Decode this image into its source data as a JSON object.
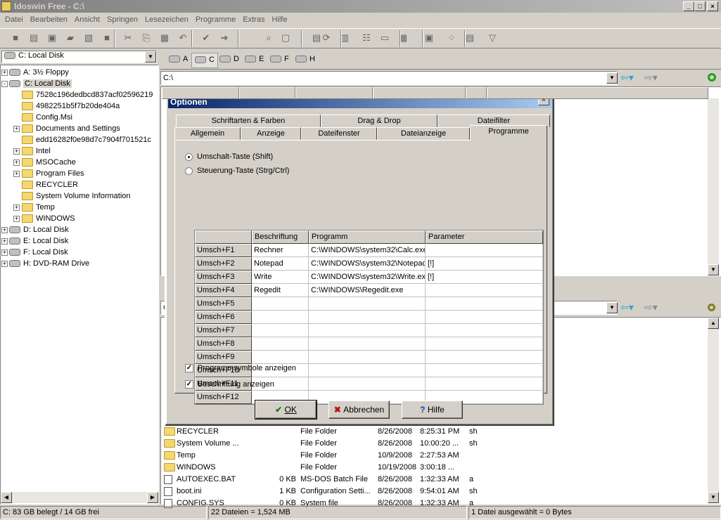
{
  "window": {
    "title": "Idoswin Free - C:\\",
    "controls": [
      "_",
      "□",
      "×"
    ]
  },
  "menu": [
    "Datei",
    "Bearbeiten",
    "Ansicht",
    "Springen",
    "Lesezeichen",
    "Programme",
    "Extras",
    "Hilfe"
  ],
  "toolbar_icons": [
    "stop",
    "properties",
    "cmd",
    "new-folder",
    "move",
    "delete",
    "cut",
    "copy",
    "paste",
    "undo",
    "check",
    "exit",
    "find",
    "folder-view",
    "list",
    "refresh",
    "folder-compare",
    "details",
    "small-icons",
    "grid",
    "preview",
    "thumbs",
    "text",
    "filter"
  ],
  "left": {
    "drive_combo": "C: Local Disk",
    "tree": [
      {
        "label": "A: 3½ Floppy",
        "level": 0,
        "type": "disk",
        "exp": "+"
      },
      {
        "label": "C: Local Disk",
        "level": 0,
        "type": "disk",
        "exp": "-",
        "selected": true
      },
      {
        "label": "7528c196dedbcd837acf02596219",
        "level": 1,
        "type": "folder"
      },
      {
        "label": "4982251b5f7b20de404a",
        "level": 1,
        "type": "folder"
      },
      {
        "label": "Config.Msi",
        "level": 1,
        "type": "folder"
      },
      {
        "label": "Documents and Settings",
        "level": 1,
        "type": "folder",
        "exp": "+"
      },
      {
        "label": "edd16282f0e98d7c7904f701521c",
        "level": 1,
        "type": "folder"
      },
      {
        "label": "Intel",
        "level": 1,
        "type": "folder",
        "exp": "+"
      },
      {
        "label": "MSOCache",
        "level": 1,
        "type": "folder",
        "exp": "+"
      },
      {
        "label": "Program Files",
        "level": 1,
        "type": "folder",
        "exp": "+"
      },
      {
        "label": "RECYCLER",
        "level": 1,
        "type": "folder"
      },
      {
        "label": "System Volume Information",
        "level": 1,
        "type": "folder"
      },
      {
        "label": "Temp",
        "level": 1,
        "type": "folder",
        "exp": "+"
      },
      {
        "label": "WINDOWS",
        "level": 1,
        "type": "folder",
        "exp": "+"
      },
      {
        "label": "D: Local Disk",
        "level": 0,
        "type": "disk",
        "exp": "+"
      },
      {
        "label": "E: Local Disk",
        "level": 0,
        "type": "disk",
        "exp": "+"
      },
      {
        "label": "F: Local Disk",
        "level": 0,
        "type": "disk",
        "exp": "+"
      },
      {
        "label": "H: DVD-RAM Drive",
        "level": 0,
        "type": "disk",
        "exp": "+"
      }
    ]
  },
  "right": {
    "drive_tabs": [
      "A",
      "C",
      "D",
      "E",
      "F",
      "H"
    ],
    "active_drive": "C",
    "path_top": "C:\\",
    "path_bottom": "C",
    "files": [
      {
        "name": "RECYCLER",
        "size": "",
        "type": "File Folder",
        "date": "8/26/2008",
        "time": "8:25:31 PM",
        "attr": "sh",
        "icon": "folder"
      },
      {
        "name": "System Volume ...",
        "size": "",
        "type": "File Folder",
        "date": "8/26/2008",
        "time": "10:00:20 ...",
        "attr": "sh",
        "icon": "folder"
      },
      {
        "name": "Temp",
        "size": "",
        "type": "File Folder",
        "date": "10/9/2008",
        "time": "2:27:53 AM",
        "attr": "",
        "icon": "folder"
      },
      {
        "name": "WINDOWS",
        "size": "",
        "type": "File Folder",
        "date": "10/19/2008",
        "time": "3:00:18 ...",
        "attr": "",
        "icon": "folder"
      },
      {
        "name": "AUTOEXEC.BAT",
        "size": "0 KB",
        "type": "MS-DOS Batch File",
        "date": "8/26/2008",
        "time": "1:32:33 AM",
        "attr": "a",
        "icon": "file"
      },
      {
        "name": "boot.ini",
        "size": "1 KB",
        "type": "Configuration Setti...",
        "date": "8/26/2008",
        "time": "9:54:01 AM",
        "attr": "sh",
        "icon": "file"
      },
      {
        "name": "CONFIG.SYS",
        "size": "0 KB",
        "type": "System file",
        "date": "8/26/2008",
        "time": "1:32:33 AM",
        "attr": "a",
        "icon": "file"
      }
    ]
  },
  "status": {
    "left": "C: 83 GB  belegt / 14 GB  frei",
    "middle": "22 Dateien = 1,524 MB",
    "right": "1 Datei ausgewählt = 0 Bytes"
  },
  "dialog": {
    "title": "Optionen",
    "close": "×",
    "tabs_row1": [
      "Schriftarten & Farben",
      "Drag & Drop",
      "Dateifilter"
    ],
    "tabs_row2": [
      "Allgemein",
      "Anzeige",
      "Dateifenster",
      "Dateianzeige",
      "Programme"
    ],
    "active_tab": "Programme",
    "radio_shift": "Umschalt-Taste (Shift)",
    "radio_ctrl": "Steuerung-Taste (Strg/Ctrl)",
    "radio_selected": "shift",
    "columns": [
      "Beschriftung",
      "Programm",
      "Parameter"
    ],
    "rows": [
      {
        "key": "Umsch+F1",
        "label": "Rechner",
        "program": "C:\\WINDOWS\\system32\\Calc.exe",
        "param": ""
      },
      {
        "key": "Umsch+F2",
        "label": "Notepad",
        "program": "C:\\WINDOWS\\system32\\Notepad.exe",
        "param": "[!]"
      },
      {
        "key": "Umsch+F3",
        "label": "Write",
        "program": "C:\\WINDOWS\\system32\\Write.exe",
        "param": "[!]"
      },
      {
        "key": "Umsch+F4",
        "label": "Regedit",
        "program": "C:\\WINDOWS\\Regedit.exe",
        "param": ""
      },
      {
        "key": "Umsch+F5",
        "label": "",
        "program": "",
        "param": ""
      },
      {
        "key": "Umsch+F6",
        "label": "",
        "program": "",
        "param": ""
      },
      {
        "key": "Umsch+F7",
        "label": "",
        "program": "",
        "param": ""
      },
      {
        "key": "Umsch+F8",
        "label": "",
        "program": "",
        "param": ""
      },
      {
        "key": "Umsch+F9",
        "label": "",
        "program": "",
        "param": ""
      },
      {
        "key": "Umsch+F10",
        "label": "",
        "program": "",
        "param": ""
      },
      {
        "key": "Umsch+F11",
        "label": "",
        "program": "",
        "param": ""
      },
      {
        "key": "Umsch+F12",
        "label": "",
        "program": "",
        "param": ""
      }
    ],
    "check_symbols": "Programmsymbole anzeigen",
    "check_symbols_on": true,
    "check_labels": "Beschriftung anzeigen",
    "check_labels_on": true,
    "ok": "OK",
    "cancel": "Abbrechen",
    "help": "Hilfe"
  }
}
